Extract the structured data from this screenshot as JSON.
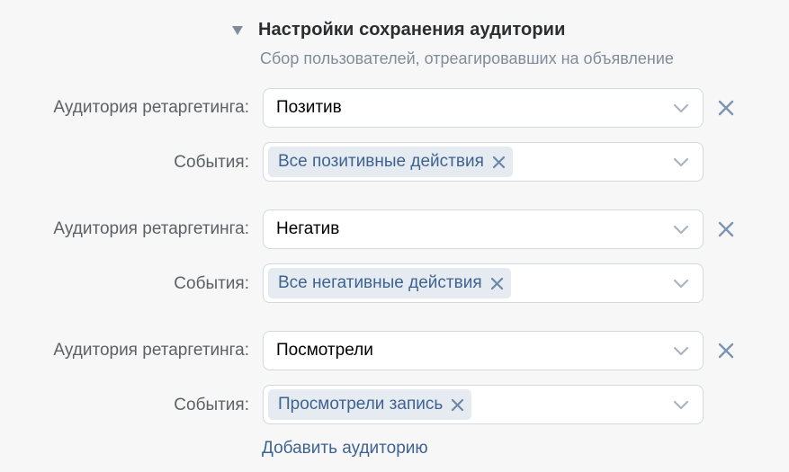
{
  "section": {
    "title": "Настройки сохранения аудитории",
    "subtitle": "Сбор пользователей, отреагировавших на объявление"
  },
  "audiences": [
    {
      "audience_label": "Аудитория ретаргетинга:",
      "audience_value": "Позитив",
      "events_label": "События:",
      "event_chip": "Все позитивные действия"
    },
    {
      "audience_label": "Аудитория ретаргетинга:",
      "audience_value": "Негатив",
      "events_label": "События:",
      "event_chip": "Все негативные действия"
    },
    {
      "audience_label": "Аудитория ретаргетинга:",
      "audience_value": "Посмотрели",
      "events_label": "События:",
      "event_chip": "Просмотрели запись"
    }
  ],
  "add_link": "Добавить аудиторию",
  "icons": {
    "collapse": "triangle-down-icon",
    "dropdown": "chevron-down-icon",
    "remove": "close-icon"
  },
  "colors": {
    "background": "#f7f7f8",
    "link": "#3f6391",
    "chip_bg": "#e5ebf1",
    "remove_icon": "#7d95b3",
    "chevron": "#aab4bf"
  }
}
